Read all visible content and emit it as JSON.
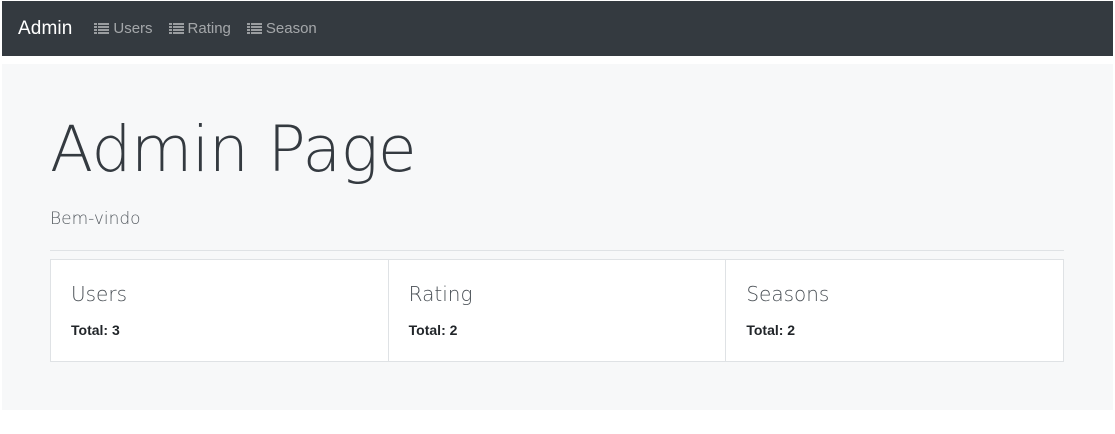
{
  "navbar": {
    "brand": "Admin",
    "links": [
      {
        "label": "Users",
        "icon": "list-icon"
      },
      {
        "label": "Rating",
        "icon": "list-icon"
      },
      {
        "label": "Season",
        "icon": "list-icon"
      }
    ],
    "colors": {
      "background": "#343a40",
      "brand": "#ffffff",
      "link": "#9a9da0"
    }
  },
  "main": {
    "title": "Admin Page",
    "subtitle": "Bem-vindo",
    "cards": [
      {
        "title": "Users",
        "total": "Total: 3"
      },
      {
        "title": "Rating",
        "total": "Total: 2"
      },
      {
        "title": "Seasons",
        "total": "Total: 2"
      }
    ],
    "colors": {
      "background": "#f7f8f9"
    }
  }
}
